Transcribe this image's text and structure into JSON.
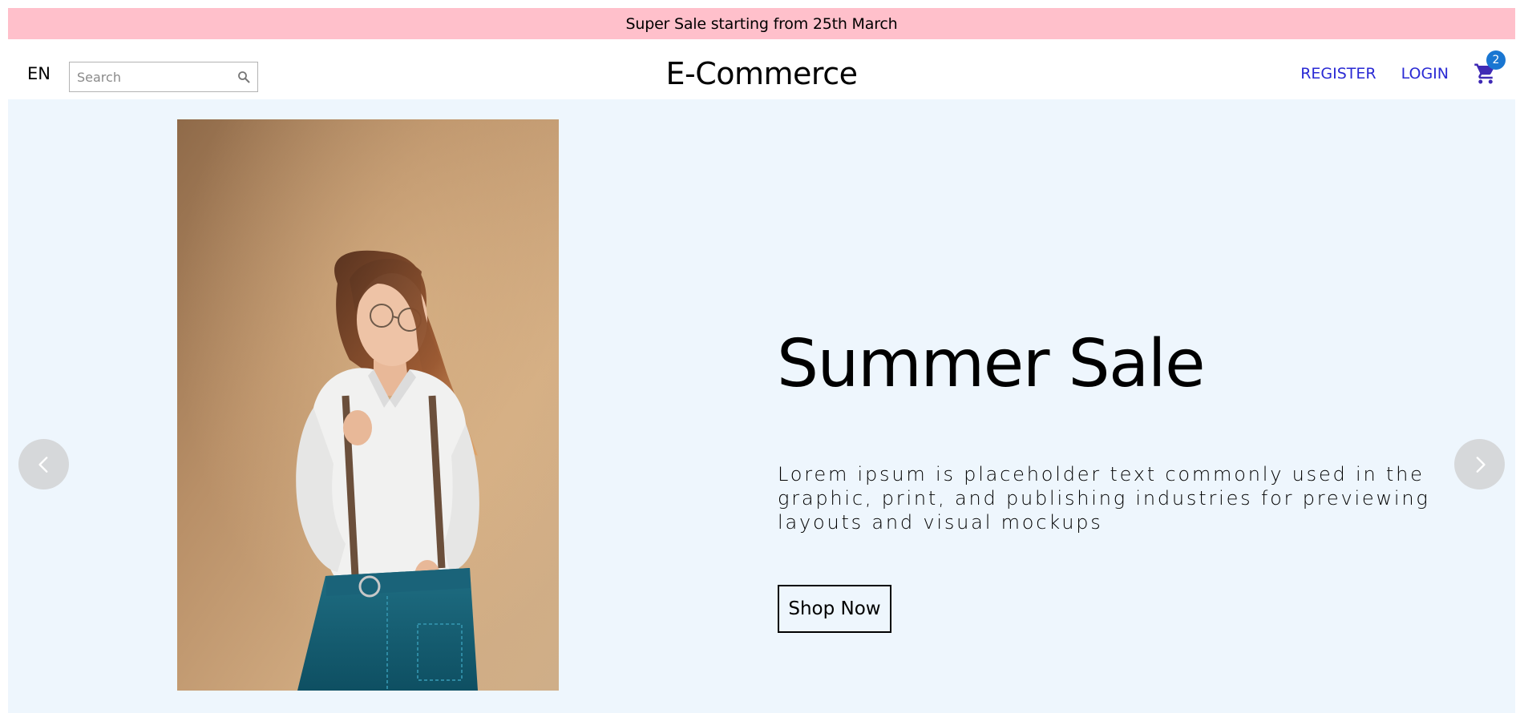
{
  "announcement": {
    "text": "Super Sale starting from 25th March"
  },
  "navbar": {
    "language": "EN",
    "search": {
      "placeholder": "Search",
      "value": ""
    },
    "logo": "E-Commerce",
    "register_label": "REGISTER",
    "login_label": "LOGIN",
    "cart_count": "2"
  },
  "hero": {
    "title": "Summer Sale",
    "description": "Lorem ipsum is placeholder text commonly used in the graphic, print, and publishing industries for previewing layouts and visual mockups",
    "button_label": "Shop Now",
    "image_alt": "woman-in-white-shirt-and-denim-skirt"
  },
  "colors": {
    "announcement_bg": "#ffc0cb",
    "hero_bg": "#eef6fd",
    "link": "#2a2ad4",
    "cart_icon": "#3f2ab5",
    "badge": "#1976d2",
    "arrow_bg": "#d6d8da"
  },
  "icons": {
    "search": "search-icon",
    "cart": "shopping-cart-icon",
    "prev": "chevron-left-icon",
    "next": "chevron-right-icon"
  }
}
